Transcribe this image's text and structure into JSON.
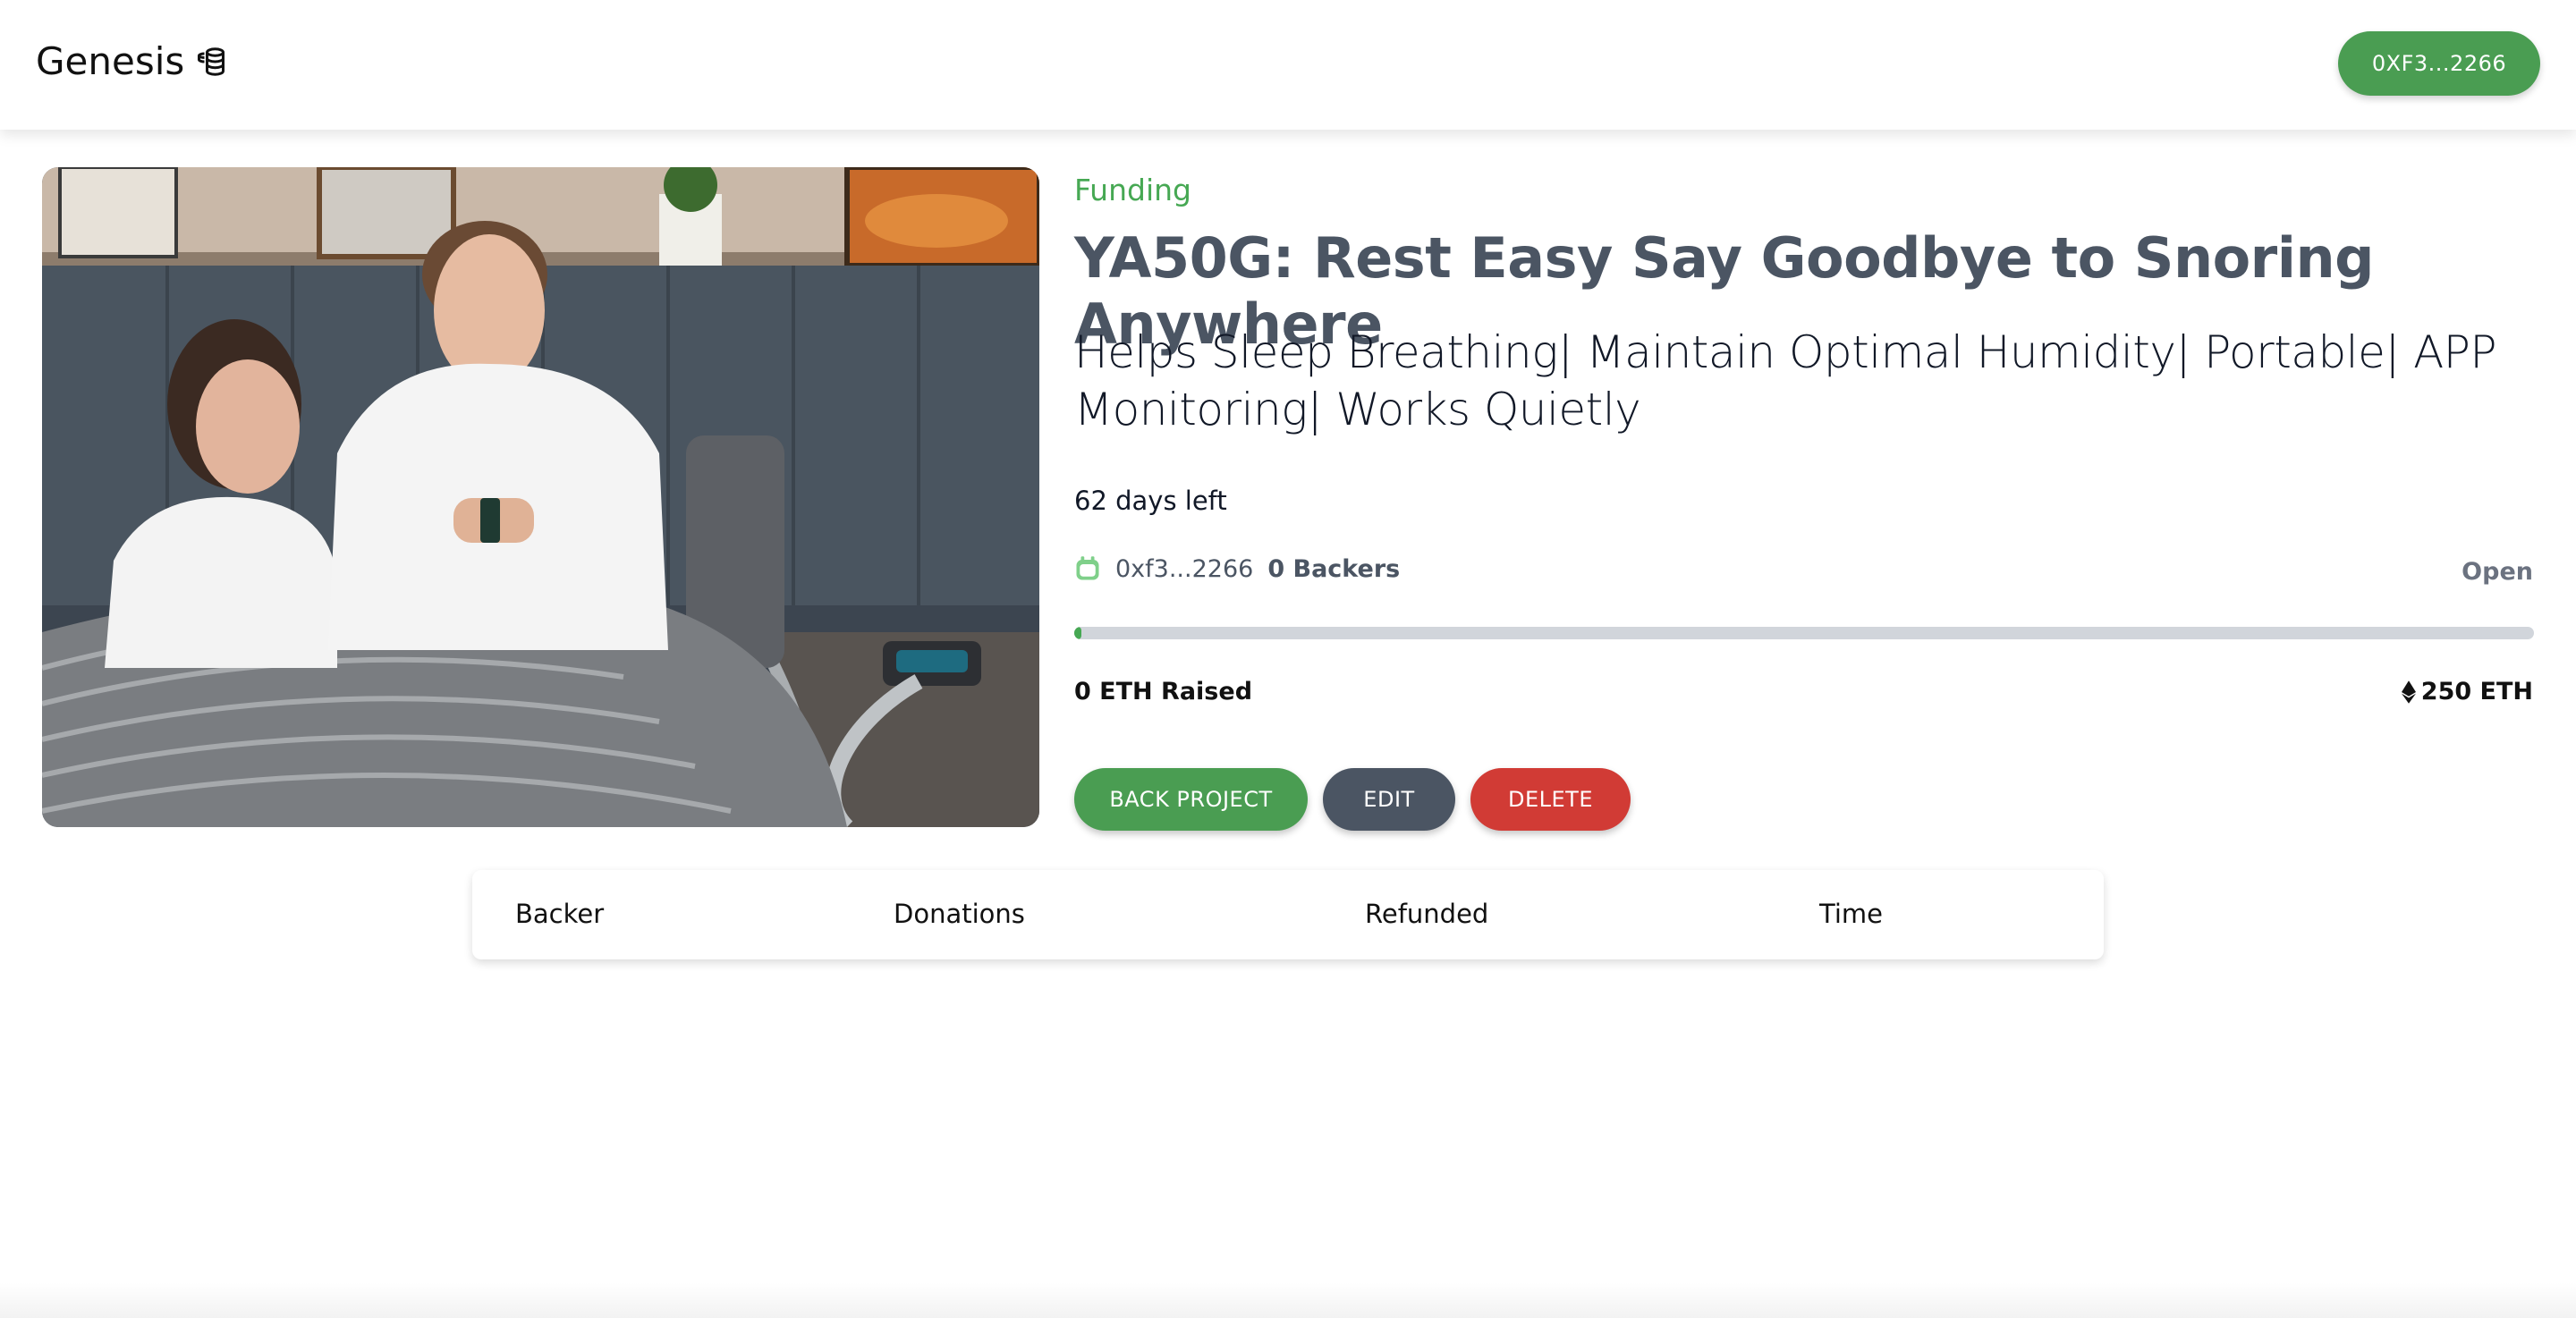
{
  "header": {
    "brand": "Genesis",
    "brand_icon": "coins-icon",
    "wallet_label": "0XF3...2266",
    "accent_color": "#4a9d52"
  },
  "project": {
    "image_description_icon": "project-photo",
    "status": "Funding",
    "title": "YA50G: Rest Easy Say Goodbye to Snoring Anywhere",
    "subtitle": "Helps Sleep Breathing| Maintain Optimal Humidity| Portable| APP Monitoring| Works Quietly",
    "days_left": "62 days left",
    "owner_address": "0xf3...2266",
    "backers": "0 Backers",
    "state": "Open",
    "raised": "0 ETH Raised",
    "goal": "250 ETH",
    "progress_fraction": 0.004
  },
  "actions": {
    "back_label": "BACK PROJECT",
    "edit_label": "EDIT",
    "delete_label": "DELETE",
    "colors": {
      "back": "#4a9d52",
      "edit": "#4b5563",
      "delete": "#d13b35"
    }
  },
  "backers_table": {
    "headers": [
      "Backer",
      "Donations",
      "Refunded",
      "Time"
    ]
  }
}
